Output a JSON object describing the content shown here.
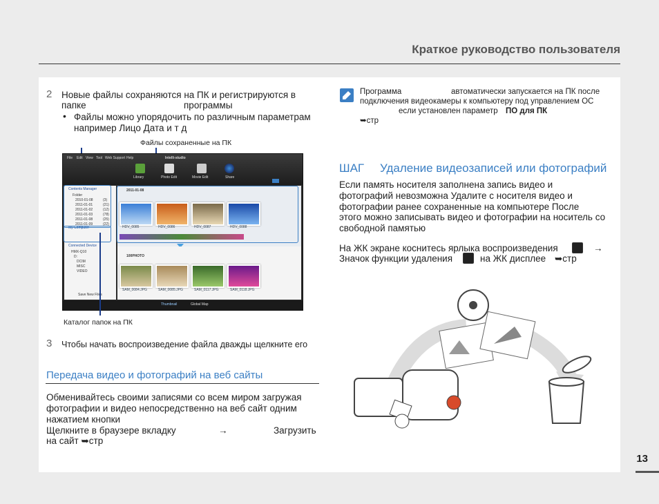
{
  "header": {
    "title": "Краткое руководство пользователя"
  },
  "left": {
    "step2": {
      "num": "2",
      "line1": "Новые файлы сохраняются на ПК и регистрируются в",
      "line2a": "папке",
      "line2b": "программы",
      "bullet_line1": "Файлы можно упорядочить по различным параметрам",
      "bullet_line2": "например   Лицо    Дата   и т  д"
    },
    "callout_top": "Файлы  сохраненные на ПК",
    "callout_bottom": "Каталог папок на ПК",
    "step3": {
      "num": "3",
      "text": "Чтобы начать воспроизведение файла  дважды щелкните его"
    },
    "web_section": {
      "heading": "Передача видео и фотографий на веб сайты",
      "p1": "Обменивайтесь своими записями со всем миром  загружая",
      "p2": "фотографии и видео непосредственно на веб сайт одним",
      "p3": "нажатием кнопки",
      "p4a": "Щелкните в браузере вкладку",
      "p4b": "→",
      "p4c": "Загрузить",
      "p5": "на сайт    ➥стр"
    }
  },
  "screenshot": {
    "app_name": "Intelli-studio",
    "menu": [
      "File",
      "Edit",
      "View",
      "Tool",
      "Web Support",
      "Help"
    ],
    "tools": [
      "Library",
      "Photo Edit",
      "Movie Edit",
      "Share"
    ],
    "sidebar_sections": [
      "Contents Manager",
      "My Computer",
      "Connected Device"
    ],
    "folder_items": [
      "Folder",
      "2010-01-08",
      "2011-01-01",
      "2011-01-02",
      "2011-01-03",
      "2011-01-08",
      "2011-01-09"
    ],
    "folder_counts": [
      "(3)",
      "(21)",
      "(12)",
      "(78)",
      "(25)",
      "(22)"
    ],
    "device_items": [
      "HMX-Q10",
      "D:",
      "DCIM",
      "MISC",
      "VIDEO"
    ],
    "group1_date": "2011-01-08",
    "group2_label": "100PHOTO",
    "video_labels": [
      "HDV_0085",
      "HDV_0086",
      "HDV_0087",
      "HDV_0088"
    ],
    "photo_labels": [
      "SAM_0084.JPG",
      "SAM_0085.JPG",
      "SAM_0117.JPG",
      "SAM_0118.JPG"
    ],
    "save_label": "Save New Files",
    "bottom_tabs": [
      "Thumbnail",
      "Global Map"
    ]
  },
  "right": {
    "note": {
      "line1a": "Программа",
      "line1b": "автоматически запускается на ПК после",
      "line2": "подключения видеокамеры к компьютеру под управлением ОС",
      "line3a": "если установлен параметр",
      "line3b": "ПО для ПК",
      "line4": "➥стр"
    },
    "step_heading": {
      "prefix": "ШАГ",
      "title": "Удаление видеозаписей или фотографий"
    },
    "p1": [
      "Если память носителя заполнена  запись видео и",
      "фотографий невозможна  Удалите с носителя видео и",
      "фотографии  ранее сохраненные на компьютере  После",
      "этого можно записывать видео и фотографии на носитель со",
      "свободной памятью"
    ],
    "p2a": "На ЖК экране коснитесь ярлыка воспроизведения",
    "p2b": "→",
    "p3a": "Значок функции удаления",
    "p3b": "на ЖК дисплее",
    "p3c": "➥стр",
    "colors": {
      "accent": "#3b7fc4",
      "note_icon": "#3b7fc4"
    }
  },
  "page_number": "13"
}
